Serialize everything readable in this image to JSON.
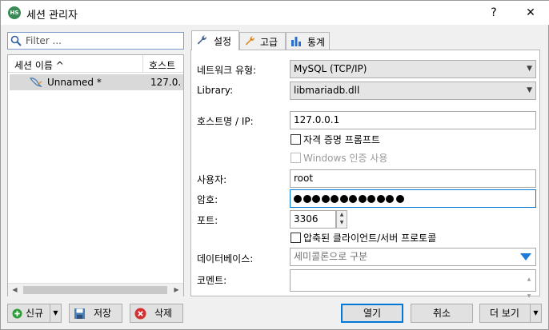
{
  "window": {
    "title": "세션 관리자",
    "app_icon_text": "HS",
    "help_label": "?",
    "close_label": "✕"
  },
  "sidebar": {
    "filter_placeholder": "Filter ...",
    "column_session_name": "세션 이름 ^",
    "column_host": "호스트",
    "sessions": [
      {
        "name": "Unnamed *",
        "host": "127.0.",
        "selected": true
      }
    ]
  },
  "bottom_left_buttons": {
    "new_label": "신규",
    "save_label": "저장",
    "delete_label": "삭제"
  },
  "tabs": [
    {
      "label": "설정",
      "icon": "wrench-icon",
      "active": true
    },
    {
      "label": "고급",
      "icon": "wrench-orange-icon",
      "active": false
    },
    {
      "label": "통계",
      "icon": "bar-chart-icon",
      "active": false
    }
  ],
  "settings": {
    "network_type_label": "네트워크 유형:",
    "network_type_value": "MySQL (TCP/IP)",
    "library_label": "Library:",
    "library_value": "libmariadb.dll",
    "hostname_label": "호스트명 / IP:",
    "hostname_value": "127.0.0.1",
    "credential_prompt_label": "자격 증명 프롬프트",
    "credential_prompt_checked": false,
    "windows_auth_label": "Windows 인증 사용",
    "windows_auth_checked": false,
    "windows_auth_enabled": false,
    "user_label": "사용자:",
    "user_value": "root",
    "password_label": "암호:",
    "password_length": 11,
    "port_label": "포트:",
    "port_value": "3306",
    "compressed_protocol_label": "압축된 클라이언트/서버 프로토콜",
    "compressed_protocol_checked": false,
    "databases_label": "데이터베이스:",
    "databases_placeholder": "세미콜론으로 구분",
    "comment_label": "코멘트:",
    "comment_value": ""
  },
  "bottom_right_buttons": {
    "open_label": "열기",
    "cancel_label": "취소",
    "more_label": "더 보기"
  },
  "colors": {
    "accent": "#0078d7",
    "selection": "#d9d9d9",
    "new_icon": "#2e9e3a",
    "delete_icon": "#d63030",
    "app_icon": "#3a8a55"
  }
}
